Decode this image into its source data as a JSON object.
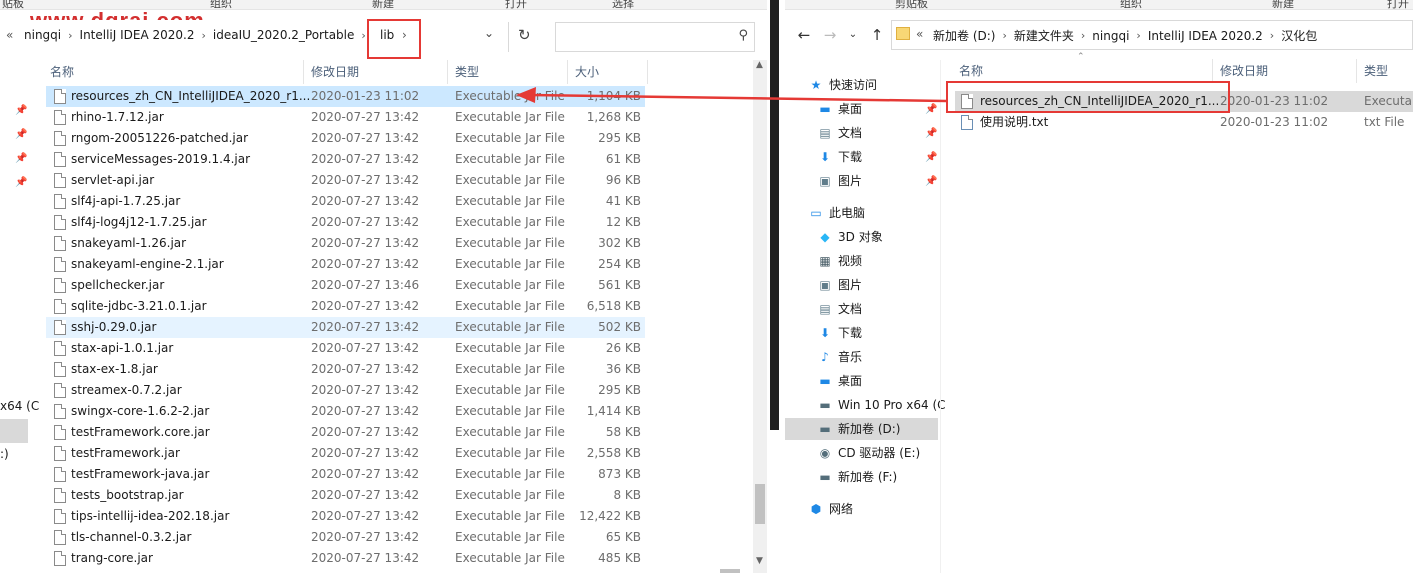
{
  "watermark": "www.dgrai.com",
  "left": {
    "ribbon": [
      "贴板",
      "组织",
      "新建",
      "打开",
      "选择"
    ],
    "breadcrumb": [
      "ningqi",
      "IntelliJ IDEA 2020.2",
      "ideaIU_2020.2_Portable",
      "lib"
    ],
    "columns": {
      "name": "名称",
      "date": "修改日期",
      "type": "类型",
      "size": "大小"
    },
    "rows": [
      {
        "name": "resources_zh_CN_IntelliJIDEA_2020_r1...",
        "date": "2020-01-23 11:02",
        "type": "Executable Jar File",
        "size": "1,104 KB"
      },
      {
        "name": "rhino-1.7.12.jar",
        "date": "2020-07-27 13:42",
        "type": "Executable Jar File",
        "size": "1,268 KB"
      },
      {
        "name": "rngom-20051226-patched.jar",
        "date": "2020-07-27 13:42",
        "type": "Executable Jar File",
        "size": "295 KB"
      },
      {
        "name": "serviceMessages-2019.1.4.jar",
        "date": "2020-07-27 13:42",
        "type": "Executable Jar File",
        "size": "61 KB"
      },
      {
        "name": "servlet-api.jar",
        "date": "2020-07-27 13:42",
        "type": "Executable Jar File",
        "size": "96 KB"
      },
      {
        "name": "slf4j-api-1.7.25.jar",
        "date": "2020-07-27 13:42",
        "type": "Executable Jar File",
        "size": "41 KB"
      },
      {
        "name": "slf4j-log4j12-1.7.25.jar",
        "date": "2020-07-27 13:42",
        "type": "Executable Jar File",
        "size": "12 KB"
      },
      {
        "name": "snakeyaml-1.26.jar",
        "date": "2020-07-27 13:42",
        "type": "Executable Jar File",
        "size": "302 KB"
      },
      {
        "name": "snakeyaml-engine-2.1.jar",
        "date": "2020-07-27 13:42",
        "type": "Executable Jar File",
        "size": "254 KB"
      },
      {
        "name": "spellchecker.jar",
        "date": "2020-07-27 13:46",
        "type": "Executable Jar File",
        "size": "561 KB"
      },
      {
        "name": "sqlite-jdbc-3.21.0.1.jar",
        "date": "2020-07-27 13:42",
        "type": "Executable Jar File",
        "size": "6,518 KB"
      },
      {
        "name": "sshj-0.29.0.jar",
        "date": "2020-07-27 13:42",
        "type": "Executable Jar File",
        "size": "502 KB"
      },
      {
        "name": "stax-api-1.0.1.jar",
        "date": "2020-07-27 13:42",
        "type": "Executable Jar File",
        "size": "26 KB"
      },
      {
        "name": "stax-ex-1.8.jar",
        "date": "2020-07-27 13:42",
        "type": "Executable Jar File",
        "size": "36 KB"
      },
      {
        "name": "streamex-0.7.2.jar",
        "date": "2020-07-27 13:42",
        "type": "Executable Jar File",
        "size": "295 KB"
      },
      {
        "name": "swingx-core-1.6.2-2.jar",
        "date": "2020-07-27 13:42",
        "type": "Executable Jar File",
        "size": "1,414 KB"
      },
      {
        "name": "testFramework.core.jar",
        "date": "2020-07-27 13:42",
        "type": "Executable Jar File",
        "size": "58 KB"
      },
      {
        "name": "testFramework.jar",
        "date": "2020-07-27 13:42",
        "type": "Executable Jar File",
        "size": "2,558 KB"
      },
      {
        "name": "testFramework-java.jar",
        "date": "2020-07-27 13:42",
        "type": "Executable Jar File",
        "size": "873 KB"
      },
      {
        "name": "tests_bootstrap.jar",
        "date": "2020-07-27 13:42",
        "type": "Executable Jar File",
        "size": "8 KB"
      },
      {
        "name": "tips-intellij-idea-202.18.jar",
        "date": "2020-07-27 13:42",
        "type": "Executable Jar File",
        "size": "12,422 KB"
      },
      {
        "name": "tls-channel-0.3.2.jar",
        "date": "2020-07-27 13:42",
        "type": "Executable Jar File",
        "size": "65 KB"
      },
      {
        "name": "trang-core.jar",
        "date": "2020-07-27 13:42",
        "type": "Executable Jar File",
        "size": "485 KB"
      }
    ],
    "side_partial": [
      "x64 (C",
      ":)"
    ]
  },
  "right": {
    "ribbon": [
      "剪贴板",
      "组织",
      "新建",
      "打开",
      "选择"
    ],
    "breadcrumb": [
      "新加卷 (D:)",
      "新建文件夹",
      "ningqi",
      "IntelliJ IDEA 2020.2",
      "汉化包"
    ],
    "columns": {
      "name": "名称",
      "date": "修改日期",
      "type": "类型"
    },
    "rows": [
      {
        "name": "resources_zh_CN_IntelliJIDEA_2020_r1...",
        "date": "2020-01-23 11:02",
        "type": "Executab"
      },
      {
        "name": "使用说明.txt",
        "date": "2020-01-23 11:02",
        "type": "txt File"
      }
    ],
    "nav": [
      {
        "label": "快速访问",
        "icon": "star-icon"
      },
      {
        "label": "桌面",
        "icon": "desktop-icon"
      },
      {
        "label": "文档",
        "icon": "document-icon"
      },
      {
        "label": "下载",
        "icon": "download-icon"
      },
      {
        "label": "图片",
        "icon": "picture-icon"
      },
      {
        "label": "此电脑",
        "icon": "computer-icon"
      },
      {
        "label": "3D 对象",
        "icon": "cube-icon"
      },
      {
        "label": "视频",
        "icon": "video-icon"
      },
      {
        "label": "图片",
        "icon": "picture-icon"
      },
      {
        "label": "文档",
        "icon": "document-icon"
      },
      {
        "label": "下载",
        "icon": "download-icon"
      },
      {
        "label": "音乐",
        "icon": "music-icon"
      },
      {
        "label": "桌面",
        "icon": "desktop-icon"
      },
      {
        "label": "Win 10 Pro x64 (C",
        "icon": "drive-icon"
      },
      {
        "label": "新加卷 (D:)",
        "icon": "drive-icon"
      },
      {
        "label": "CD 驱动器 (E:)",
        "icon": "cd-icon"
      },
      {
        "label": "新加卷 (F:)",
        "icon": "drive-icon"
      },
      {
        "label": "网络",
        "icon": "network-icon"
      }
    ]
  },
  "colors": {
    "highlight": "#e53935",
    "selection": "#cce8ff",
    "accent": "#0078d7"
  }
}
